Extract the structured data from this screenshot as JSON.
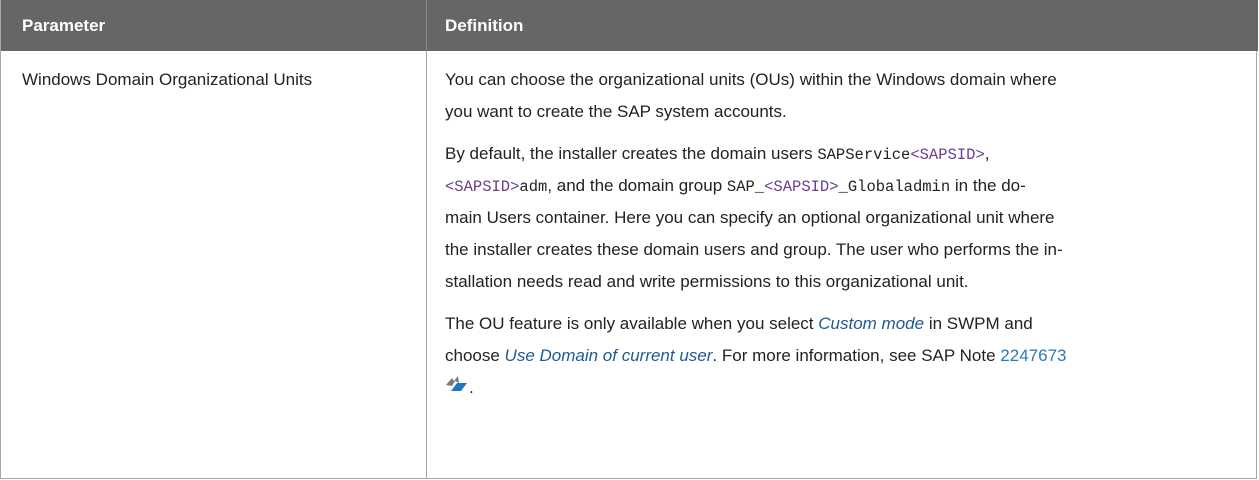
{
  "table": {
    "headers": {
      "parameter": "Parameter",
      "definition": "Definition"
    },
    "row": {
      "parameter": "Windows Domain Organizational Units",
      "definition": {
        "p1": {
          "l1": "You can choose the organizational units (OUs) within the Windows domain where",
          "l2": "you want to create the SAP system accounts."
        },
        "p2": {
          "l1_a": "By default, the installer creates the domain users ",
          "l1_code": "SAPService",
          "l1_var": "<SAPSID>",
          "l1_end": ",",
          "l2_var1": "<SAPSID>",
          "l2_code1": "adm",
          "l2_text1": ", and the domain group ",
          "l2_code2": "SAP_",
          "l2_var2": "<SAPSID>",
          "l2_code3": "_Globaladmin",
          "l2_text2": " in the do-",
          "l3": "main Users container. Here you can specify an optional organizational unit where",
          "l4": "the installer creates these domain users and group. The user who performs the in-",
          "l5": "stallation needs read and write permissions to this organizational unit."
        },
        "p3": {
          "l1_a": "The OU feature is only available when you select ",
          "l1_em": "Custom mode",
          "l1_b": " in SWPM and",
          "l2_a": "choose ",
          "l2_em": "Use Domain of current user",
          "l2_b": ". For more information, see SAP Note ",
          "l2_link": "2247673",
          "l3_end": "."
        }
      }
    }
  },
  "icons": {
    "external_link": "external-link-icon"
  },
  "colors": {
    "header_bg": "#666666",
    "header_text": "#ffffff",
    "variable": "#6b3d8c",
    "emphasis_link": "#1f5a95",
    "note_link": "#2a7ab8"
  }
}
